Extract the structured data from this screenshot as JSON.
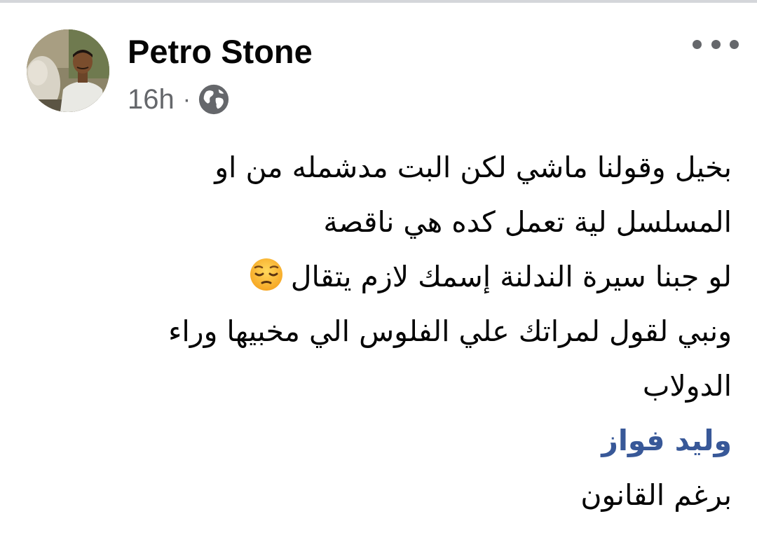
{
  "post": {
    "author_name": "Petro Stone",
    "timestamp": "16h",
    "separator": "·",
    "audience_icon": "globe-icon",
    "more_icon": "more-horizontal-icon",
    "body_lines": [
      "بخيل وقولنا ماشي لكن البت مدشمله من او",
      "المسلسل لية تعمل كده هي ناقصة",
      "لو جبنا سيرة الندلنة إسمك لازم يتقال",
      "ونبي لقول لمراتك علي الفلوس الي مخبيها وراء",
      "الدولاب"
    ],
    "emoji": "pensive-face-emoji",
    "mention": "وليد فواز",
    "after_mention": "برغم القانون"
  },
  "colors": {
    "text_primary": "#050505",
    "text_secondary": "#65676b",
    "mention_link": "#385898",
    "divider": "#d4d6da"
  }
}
